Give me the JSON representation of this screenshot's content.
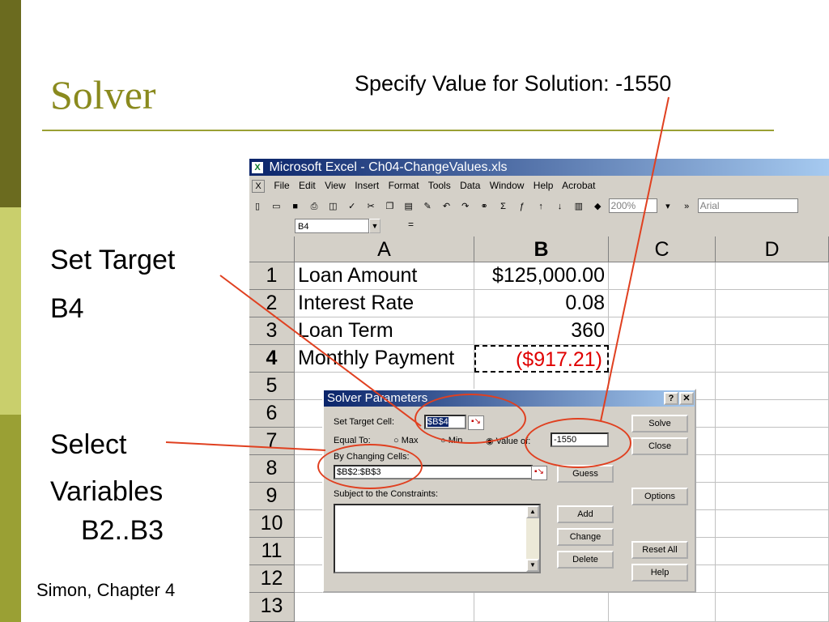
{
  "slide": {
    "title": "Solver",
    "annotation_top": "Specify Value for Solution:  -1550",
    "set_target_line1": "Set Target",
    "set_target_line2": "B4",
    "select_line1": "Select",
    "select_line2": "Variables",
    "select_line3": "B2..B3",
    "footer": "Simon, Chapter 4"
  },
  "excel": {
    "title": "Microsoft Excel - Ch04-ChangeValues.xls",
    "menu": [
      "File",
      "Edit",
      "View",
      "Insert",
      "Format",
      "Tools",
      "Data",
      "Window",
      "Help",
      "Acrobat"
    ],
    "zoom": "200%",
    "font": "Arial",
    "name_box": "B4",
    "formula_eq": "=",
    "columns": [
      "A",
      "B",
      "C",
      "D"
    ],
    "rows": [
      {
        "num": "1",
        "a": "Loan Amount",
        "b": "$125,000.00"
      },
      {
        "num": "2",
        "a": "Interest Rate",
        "b": "0.08"
      },
      {
        "num": "3",
        "a": "Loan Term",
        "b": "360"
      },
      {
        "num": "4",
        "a": "Monthly Payment",
        "b": "($917.21)"
      },
      {
        "num": "5",
        "a": "",
        "b": ""
      },
      {
        "num": "6",
        "a": "",
        "b": ""
      },
      {
        "num": "7",
        "a": "",
        "b": ""
      },
      {
        "num": "8",
        "a": "",
        "b": ""
      },
      {
        "num": "9",
        "a": "",
        "b": ""
      },
      {
        "num": "10",
        "a": "",
        "b": ""
      },
      {
        "num": "11",
        "a": "",
        "b": ""
      },
      {
        "num": "12",
        "a": "",
        "b": ""
      },
      {
        "num": "13",
        "a": "",
        "b": ""
      }
    ]
  },
  "solver": {
    "title": "Solver Parameters",
    "help_btn": "?",
    "close_x": "✕",
    "set_target_label": "Set Target Cell:",
    "set_target_value": "$B$4",
    "equal_to_label": "Equal To:",
    "max_label": "Max",
    "min_label": "Min",
    "value_of_label": "Value of:",
    "value_of": "-1550",
    "by_changing_label": "By Changing Cells:",
    "by_changing_value": "$B$2:$B$3",
    "constraints_label": "Subject to the Constraints:",
    "buttons": {
      "solve": "Solve",
      "close": "Close",
      "guess": "Guess",
      "options": "Options",
      "add": "Add",
      "change": "Change",
      "delete": "Delete",
      "reset_all": "Reset All",
      "help": "Help"
    }
  },
  "colors": {
    "accent": "#8a8a1e",
    "annotation": "#e04020",
    "negative": "#e00000"
  }
}
